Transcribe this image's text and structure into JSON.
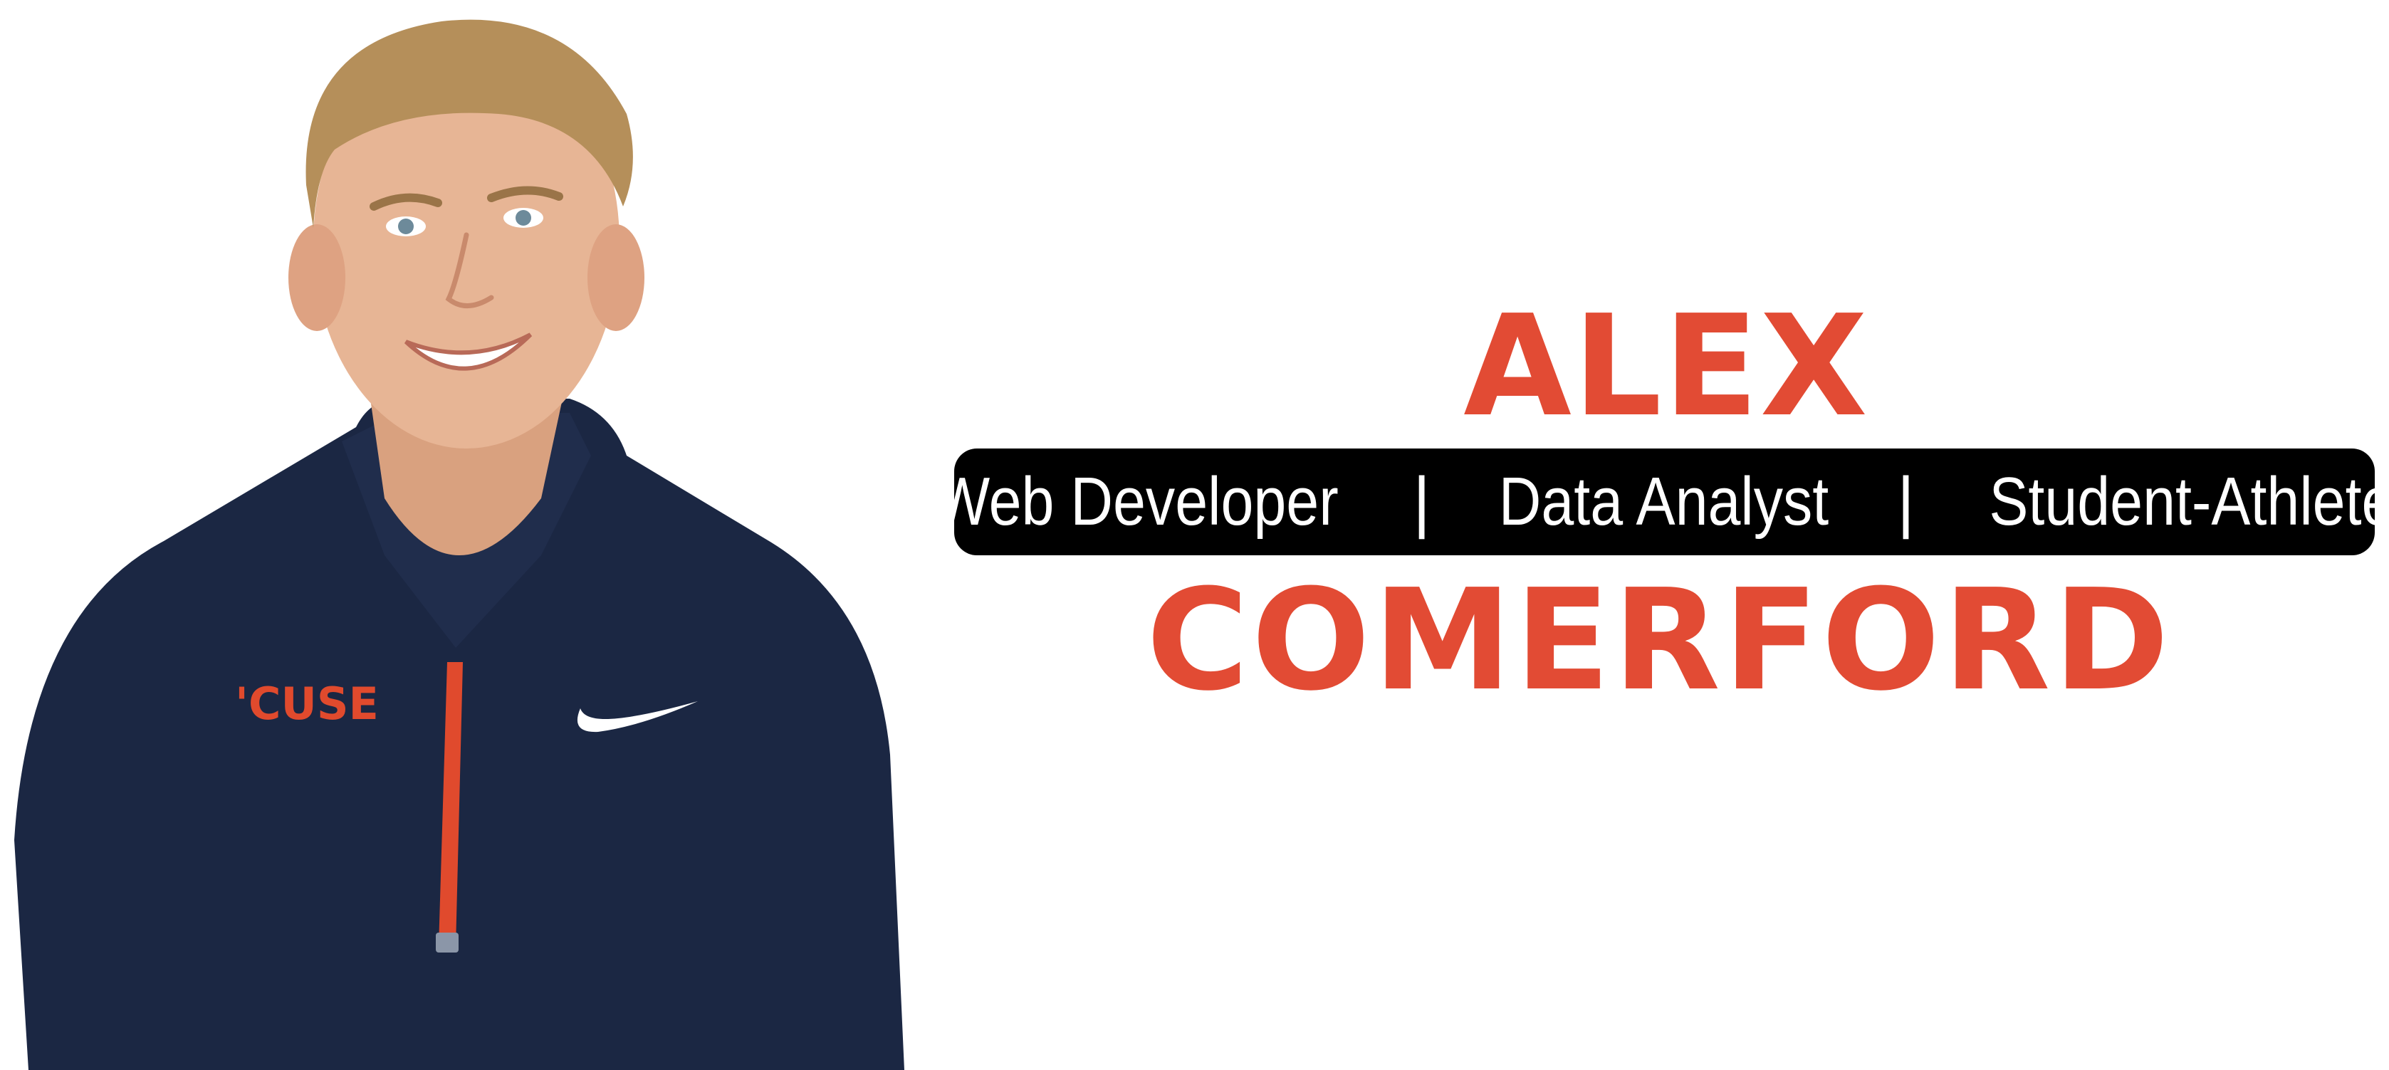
{
  "hero": {
    "first_name": "ALEX",
    "last_name": "COMERFORD",
    "roles": [
      "Web Developer",
      "Data Analyst",
      "Student-Athlete"
    ],
    "separator": "|",
    "jacket_text": "'CUSE"
  },
  "colors": {
    "accent": "#e24b34",
    "tagline_bg": "#000000",
    "tagline_text": "#ffffff",
    "jacket": "#1b2743"
  },
  "portrait": {
    "icon": "person-portrait",
    "logo": "swoosh-logo"
  }
}
